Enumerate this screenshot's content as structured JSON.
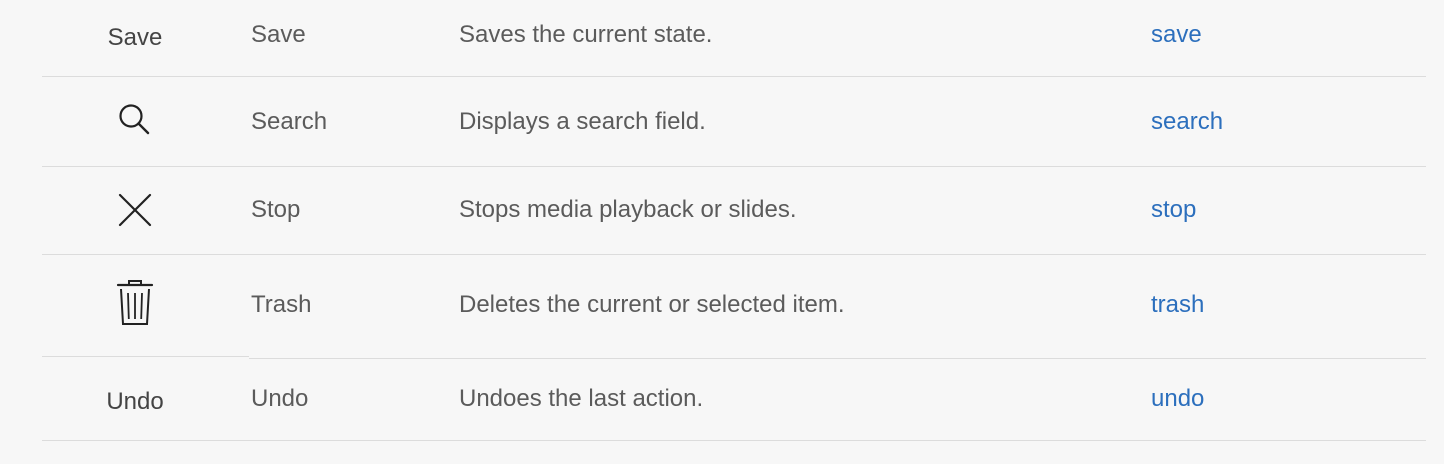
{
  "rows": [
    {
      "symbol": "Save",
      "name": "Save",
      "description": "Saves the current state.",
      "code": "save"
    },
    {
      "icon": "search-icon",
      "name": "Search",
      "description": "Displays a search field.",
      "code": "search"
    },
    {
      "icon": "close-icon",
      "name": "Stop",
      "description": "Stops media playback or slides.",
      "code": "stop"
    },
    {
      "icon": "trash-icon",
      "name": "Trash",
      "description": "Deletes the current or selected item.",
      "code": "trash"
    },
    {
      "symbol": "Undo",
      "name": "Undo",
      "description": "Undoes the last action.",
      "code": "undo"
    }
  ],
  "colors": {
    "text": "#5b5b5b",
    "link": "#2c6fbd",
    "divider": "#dcdcdc",
    "background": "#f7f7f7"
  }
}
